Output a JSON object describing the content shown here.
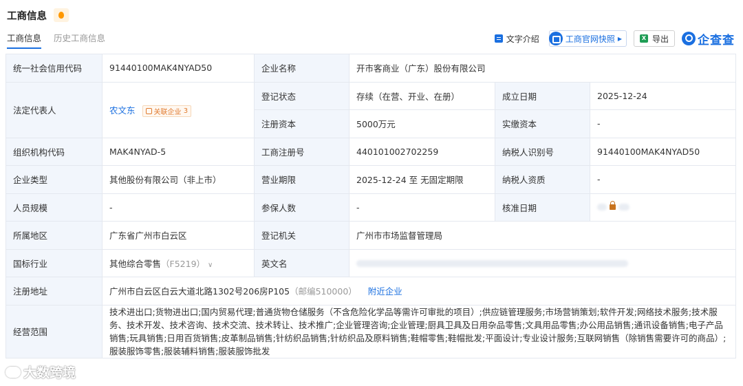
{
  "header": {
    "title": "工商信息"
  },
  "tabs": [
    {
      "label": "工商信息",
      "active": true
    },
    {
      "label": "历史工商信息",
      "active": false
    }
  ],
  "toolbar": {
    "text_intro": "文字介绍",
    "snapshot": "工商官网快照",
    "export": "导出",
    "brand": "企查查"
  },
  "rows": {
    "credit_code": {
      "label": "统一社会信用代码",
      "value": "91440100MAK4NYAD50"
    },
    "company_name": {
      "label": "企业名称",
      "value": "开市客商业（广东）股份有限公司"
    },
    "legal_rep": {
      "label": "法定代表人",
      "value": "农文东",
      "related_tag": "关联企业",
      "related_count": "3"
    },
    "reg_status": {
      "label": "登记状态",
      "value": "存续（在营、开业、在册）"
    },
    "founded": {
      "label": "成立日期",
      "value": "2025-12-24"
    },
    "reg_capital": {
      "label": "注册资本",
      "value": "5000万元"
    },
    "paid_capital": {
      "label": "实缴资本",
      "value": "-"
    },
    "org_code": {
      "label": "组织机构代码",
      "value": "MAK4NYAD-5"
    },
    "reg_number": {
      "label": "工商注册号",
      "value": "440101002702259"
    },
    "taxpayer_id": {
      "label": "纳税人识别号",
      "value": "91440100MAK4NYAD50"
    },
    "company_type": {
      "label": "企业类型",
      "value": "其他股份有限公司（非上市）"
    },
    "biz_term": {
      "label": "营业期限",
      "value": "2025-12-24 至 无固定期限"
    },
    "taxpayer_qual": {
      "label": "纳税人资质",
      "value": "-"
    },
    "staff_size": {
      "label": "人员规模",
      "value": "-"
    },
    "insured": {
      "label": "参保人数",
      "value": "-"
    },
    "approval_date": {
      "label": "核准日期"
    },
    "region": {
      "label": "所属地区",
      "value": "广东省广州市白云区"
    },
    "reg_authority": {
      "label": "登记机关",
      "value": "广州市市场监督管理局"
    },
    "industry": {
      "label": "国标行业",
      "value": "其他综合零售",
      "code": "（F5219）"
    },
    "english_name": {
      "label": "英文名"
    },
    "address": {
      "label": "注册地址",
      "value": "广州市白云区白云大道北路1302号206房P105",
      "postcode": "（邮编510000）",
      "nearby": "附近企业"
    },
    "scope": {
      "label": "经营范围",
      "value": "技术进出口;货物进出口;国内贸易代理;普通货物仓储服务（不含危险化学品等需许可审批的项目）;供应链管理服务;市场营销策划;软件开发;网络技术服务;技术服务、技术开发、技术咨询、技术交流、技术转让、技术推广;企业管理咨询;企业管理;厨具卫具及日用杂品零售;文具用品零售;办公用品销售;通讯设备销售;电子产品销售;玩具销售;日用百货销售;皮革制品销售;针纺织品销售;针纺织品及原料销售;鞋帽零售;鞋帽批发;平面设计;专业设计服务;互联网销售（除销售需要许可的商品）;服装服饰零售;服装辅料销售;服装服饰批发"
    }
  },
  "watermark": "大数跨境",
  "colors": {
    "accent": "#1a6fe0",
    "label_bg": "#f2f6fc",
    "border": "#e4e8ef",
    "tag_orange": "#e07a2e"
  }
}
